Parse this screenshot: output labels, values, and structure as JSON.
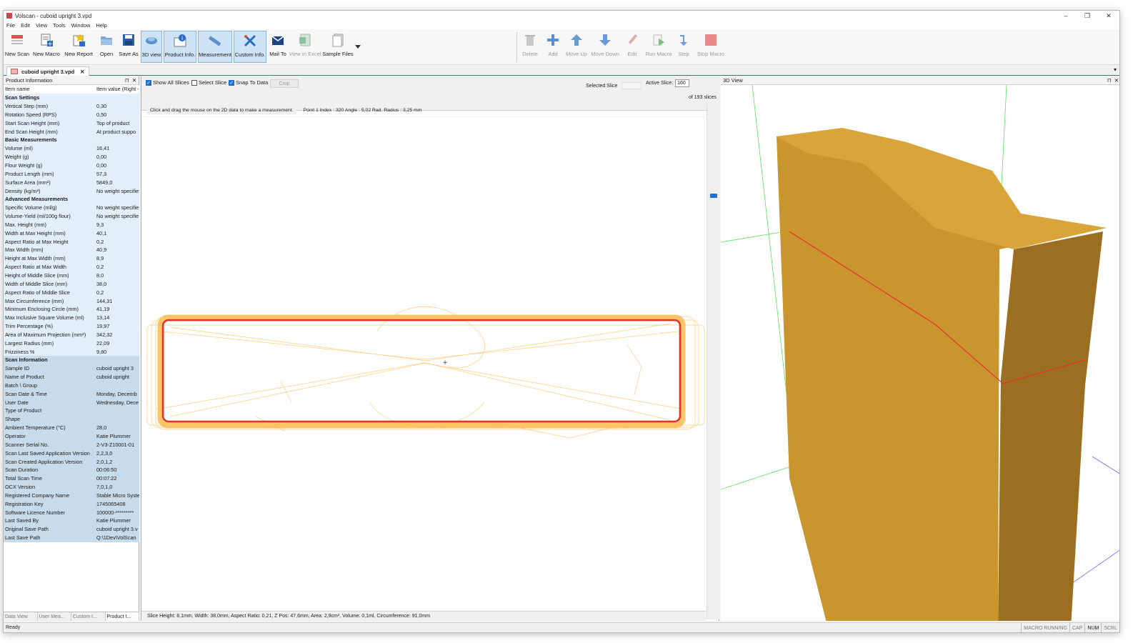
{
  "window": {
    "title": "Volscan - cuboid upright 3.vpd",
    "min": "–",
    "max": "❐",
    "close": "✕"
  },
  "menu": [
    "File",
    "Edit",
    "View",
    "Tools",
    "Window",
    "Help"
  ],
  "toolbar": {
    "left": [
      {
        "label": "New Scan",
        "icon": "new-scan-icon"
      },
      {
        "label": "New Macro",
        "icon": "new-macro-icon"
      },
      {
        "label": "New Report",
        "icon": "new-report-icon"
      },
      {
        "label": "Open",
        "icon": "open-folder-icon"
      },
      {
        "label": "Save As",
        "icon": "save-icon"
      },
      {
        "label": "3D view",
        "icon": "3d-view-icon",
        "active": true
      },
      {
        "label": "Product Info.",
        "icon": "info-icon",
        "active": true
      },
      {
        "label": "Measurement",
        "icon": "ruler-icon",
        "active": true
      },
      {
        "label": "Custom Info.",
        "icon": "custom-info-icon",
        "active": true
      },
      {
        "label": "Mail To",
        "icon": "mail-icon"
      },
      {
        "label": "View In Excel",
        "icon": "excel-icon",
        "disabled": true
      },
      {
        "label": "Sample Files",
        "icon": "sample-files-icon"
      }
    ],
    "right": [
      {
        "label": "Delete",
        "icon": "trash-icon",
        "disabled": true
      },
      {
        "label": "Add",
        "icon": "plus-icon",
        "disabled": true
      },
      {
        "label": "Move Up",
        "icon": "arrow-up-icon",
        "disabled": true
      },
      {
        "label": "Move Down",
        "icon": "arrow-down-icon",
        "disabled": true
      },
      {
        "label": "Edit",
        "icon": "pencil-icon",
        "disabled": true
      },
      {
        "label": "Run Macro",
        "icon": "run-macro-icon",
        "disabled": true
      },
      {
        "label": "Step",
        "icon": "step-icon",
        "disabled": true
      },
      {
        "label": "Stop Macro",
        "icon": "stop-icon",
        "disabled": true
      }
    ]
  },
  "doc_tab": {
    "label": "cuboid upright 3.vpd",
    "close": "✕"
  },
  "left_panel": {
    "title": "Product Information",
    "pin": "⊓",
    "close": "✕",
    "header": [
      "Item name",
      "Item value (Right -"
    ],
    "rows": [
      {
        "type": "sec",
        "name": "Scan Settings",
        "value": ""
      },
      {
        "type": "row-light",
        "name": "Vertical Step (mm)",
        "value": "0,30"
      },
      {
        "type": "row-light",
        "name": "Rotation Speed (RPS)",
        "value": "0,50"
      },
      {
        "type": "row-light",
        "name": "Start Scan Height (mm)",
        "value": "Top of product"
      },
      {
        "type": "row-light",
        "name": "End Scan Height (mm)",
        "value": "At product suppo"
      },
      {
        "type": "sec",
        "name": "Basic Measurements",
        "value": ""
      },
      {
        "type": "row-light",
        "name": "Volume (ml)",
        "value": "16,41"
      },
      {
        "type": "row-light",
        "name": "Weight (g)",
        "value": "0,00"
      },
      {
        "type": "row-light",
        "name": "Flour Weight (g)",
        "value": "0,00"
      },
      {
        "type": "row-light",
        "name": "Product Length (mm)",
        "value": "57,3"
      },
      {
        "type": "row-light",
        "name": "Surface Area (mm²)",
        "value": "5849,0"
      },
      {
        "type": "row-light",
        "name": "Density (kg/m³)",
        "value": "No weight specifie"
      },
      {
        "type": "sec",
        "name": "Advanced Measurements",
        "value": ""
      },
      {
        "type": "row-light",
        "name": "Specific Volume (ml/g)",
        "value": "No weight specifie"
      },
      {
        "type": "row-light",
        "name": "Volume-Yield (ml/100g flour)",
        "value": "No weight specifie"
      },
      {
        "type": "row-light",
        "name": "Max. Height (mm)",
        "value": "9,3"
      },
      {
        "type": "row-light",
        "name": "Width at Max Height (mm)",
        "value": "40,1"
      },
      {
        "type": "row-light",
        "name": "Aspect Ratio at Max Height",
        "value": "0,2"
      },
      {
        "type": "row-light",
        "name": "Max Width (mm)",
        "value": "40,9"
      },
      {
        "type": "row-light",
        "name": "Height at Max Width (mm)",
        "value": "8,9"
      },
      {
        "type": "row-light",
        "name": "Aspect Ratio at Max Width",
        "value": "0,2"
      },
      {
        "type": "row-light",
        "name": "Height of Middle Slice (mm)",
        "value": "8,0"
      },
      {
        "type": "row-light",
        "name": "Width of Middle Slice (mm)",
        "value": "38,0"
      },
      {
        "type": "row-light",
        "name": "Aspect Ratio of Middle Slice",
        "value": "0,2"
      },
      {
        "type": "row-light",
        "name": "Max Circumference (mm)",
        "value": "144,31"
      },
      {
        "type": "row-light",
        "name": "Minimum Enclosing Circle (mm)",
        "value": "41,19"
      },
      {
        "type": "row-light",
        "name": "Max Inclusive Square Volume (ml)",
        "value": "13,14"
      },
      {
        "type": "row-light",
        "name": "Trim Percentage (%)",
        "value": "19,97"
      },
      {
        "type": "row-light",
        "name": "Area of Maximum Projection (mm²)",
        "value": "342,32"
      },
      {
        "type": "row-light",
        "name": "Largest Radius (mm)",
        "value": "22,09"
      },
      {
        "type": "row-light",
        "name": "Frizziness %",
        "value": "9,80"
      },
      {
        "type": "sec-dark",
        "name": "Scan Information",
        "value": ""
      },
      {
        "type": "row-dark",
        "name": "Sample ID",
        "value": "cuboid upright 3"
      },
      {
        "type": "row-dark",
        "name": "Name of Product",
        "value": "cuboid upright"
      },
      {
        "type": "row-dark",
        "name": "Batch \\ Group",
        "value": ""
      },
      {
        "type": "row-dark",
        "name": "Scan Date & Time",
        "value": "Monday, Decemb"
      },
      {
        "type": "row-dark",
        "name": "User Date",
        "value": "Wednesday, Dece"
      },
      {
        "type": "row-dark",
        "name": "Type of Product",
        "value": ""
      },
      {
        "type": "row-dark",
        "name": "Shape",
        "value": ""
      },
      {
        "type": "row-dark",
        "name": "Ambient Temperature (°C)",
        "value": "28,0"
      },
      {
        "type": "row-dark",
        "name": "Operator",
        "value": "Katie Plummer"
      },
      {
        "type": "row-dark",
        "name": "Scanner Serial No.",
        "value": "2-V3-Z10001-01"
      },
      {
        "type": "row-dark",
        "name": "Scan Last Saved Application Version",
        "value": "2,2,3,0"
      },
      {
        "type": "row-dark",
        "name": "Scan Created Application Version",
        "value": "2,0,1,2"
      },
      {
        "type": "row-dark",
        "name": "Scan Duration",
        "value": "00:06:50"
      },
      {
        "type": "row-dark",
        "name": "Total Scan Time",
        "value": "00:07:22"
      },
      {
        "type": "row-dark",
        "name": "OCX Version",
        "value": "7,0,1,0"
      },
      {
        "type": "row-dark",
        "name": "Registered Company Name",
        "value": "Stable Micro Syste"
      },
      {
        "type": "row-dark",
        "name": "Registration Key",
        "value": "1745065408"
      },
      {
        "type": "row-dark",
        "name": "Software Licence Number",
        "value": "100000-*********"
      },
      {
        "type": "row-dark",
        "name": "Last Saved By",
        "value": "Katie Plummer"
      },
      {
        "type": "row-dark",
        "name": "Original Save Path",
        "value": "cuboid upright 3.v"
      },
      {
        "type": "row-dark",
        "name": "Last Save Path",
        "value": "Q:\\1Dev\\VolScan"
      }
    ],
    "bottom_tabs": [
      "Data View",
      "User Mea...",
      "Custom I...",
      "Product I..."
    ]
  },
  "center": {
    "show_all_slices": "Show All Slices",
    "select_slice": "Select Slice",
    "snap_to_data": "Snap To Data",
    "crop": "Crop",
    "selected_slice_label": "Selected Slice",
    "active_slice_label": "Active Slice:",
    "active_slice_value": "160",
    "of_slices": "of  193 slices",
    "hint": "Click and drag the mouse on the 2D data to make a measurement.",
    "point_info": "Point 1 Index : 320 Angle : 5,02 Rad. Radius : 3,25 mm",
    "status": "Slice Height: 8,1mm, Width: 38,0mm, Aspect Ratio: 0,21, Z Pos: 47,6mm, Area: 2,9cm², Volume: 0,1ml, Circumference: 91,0mm"
  },
  "view3d": {
    "title": "3D View",
    "pin": "⊓",
    "close": "✕"
  },
  "statusbar": {
    "text": "Ready",
    "indicators": [
      "MACRO RUNNING",
      "CAP",
      "NUM",
      "SCRL"
    ]
  },
  "colors": {
    "accent": "#1f6fd1",
    "slice_red": "#e8302a",
    "slice_orange": "#ffb347",
    "product": "#c9952e"
  }
}
